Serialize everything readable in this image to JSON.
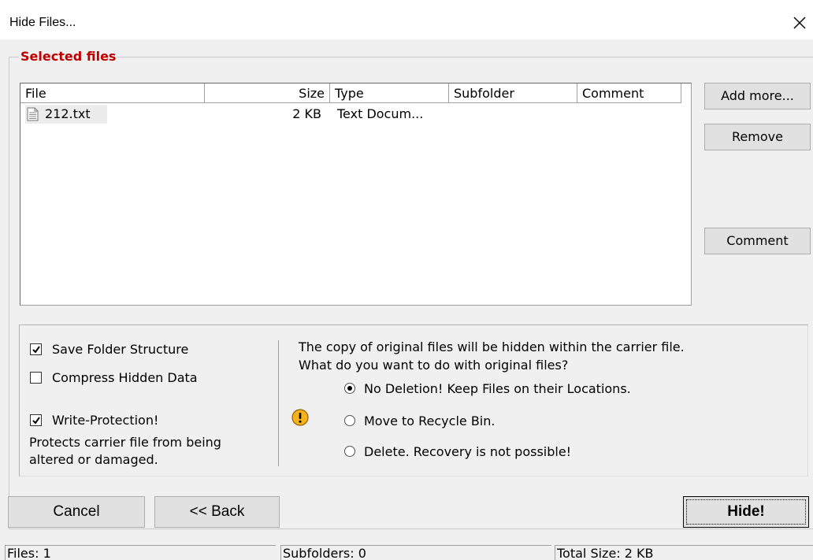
{
  "window": {
    "title": "Hide Files..."
  },
  "group": {
    "title": "Selected files"
  },
  "list": {
    "columns": [
      "File",
      "Size",
      "Type",
      "Subfolder",
      "Comment"
    ],
    "rows": [
      {
        "file": "212.txt",
        "size": "2 KB",
        "type": "Text Docum...",
        "subfolder": "",
        "comment": ""
      }
    ]
  },
  "side_buttons": {
    "add_more": "Add more...",
    "remove": "Remove",
    "comment": "Comment"
  },
  "options": {
    "save_folder_structure": {
      "label": "Save Folder Structure",
      "checked": true
    },
    "compress_hidden_data": {
      "label": "Compress Hidden Data",
      "checked": false
    },
    "write_protection": {
      "label": "Write-Protection!",
      "checked": true
    },
    "write_protection_desc_1": "Protects carrier file from being",
    "write_protection_desc_2": "altered or damaged.",
    "info_line_1": "The copy of original files will be hidden within the carrier file.",
    "info_line_2": "What do you want to do with original files?",
    "radio_options": [
      {
        "label": "No Deletion! Keep Files on their Locations.",
        "selected": true
      },
      {
        "label": "Move to Recycle Bin.",
        "selected": false
      },
      {
        "label": "Delete. Recovery is not possible!",
        "selected": false
      }
    ]
  },
  "buttons": {
    "cancel": "Cancel",
    "back": "<< Back",
    "hide": "Hide!"
  },
  "status": {
    "files": "Files: 1",
    "subfolders": "Subfolders: 0",
    "total_size": "Total Size: 2 KB"
  }
}
